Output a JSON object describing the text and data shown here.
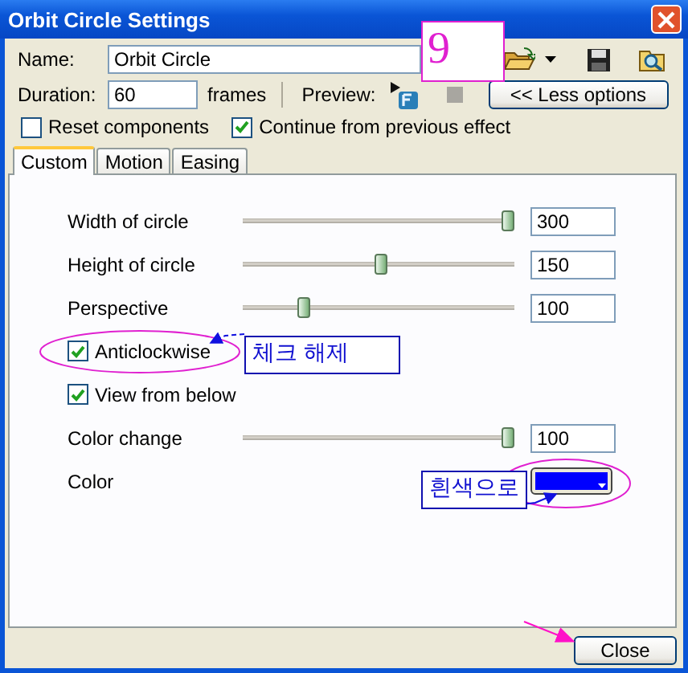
{
  "window": {
    "title": "Orbit Circle Settings"
  },
  "name_field": {
    "label": "Name:",
    "value": "Orbit Circle"
  },
  "duration_field": {
    "label": "Duration:",
    "value": "60",
    "unit": "frames"
  },
  "preview": {
    "label": "Preview:"
  },
  "less_options_button": "<< Less options",
  "options": [
    {
      "label": "Reset components",
      "checked": false
    },
    {
      "label": "Continue from previous effect",
      "checked": true
    }
  ],
  "tabs": [
    {
      "label": "Custom",
      "selected": true
    },
    {
      "label": "Motion",
      "selected": false
    },
    {
      "label": "Easing",
      "selected": false
    }
  ],
  "settings": [
    {
      "kind": "slider",
      "label": "Width of circle",
      "level": 1,
      "value": "300"
    },
    {
      "kind": "slider",
      "label": "Height of circle",
      "level": 0.51,
      "value": "150"
    },
    {
      "kind": "slider",
      "label": "Perspective",
      "level": 0.21,
      "value": "100"
    },
    {
      "kind": "checkbox",
      "label": "Anticlockwise",
      "checked": true
    },
    {
      "kind": "checkbox",
      "label": "View from below",
      "checked": true
    },
    {
      "kind": "slider",
      "label": "Color change",
      "level": 1,
      "value": "100"
    },
    {
      "kind": "color",
      "label": "Color",
      "color": "#0000ff"
    }
  ],
  "annotations": [
    {
      "kind": "number",
      "text": "9"
    },
    {
      "kind": "callout",
      "text": "체크 해제"
    },
    {
      "kind": "callout",
      "text": "흰색으로"
    }
  ],
  "close_button": "Close"
}
